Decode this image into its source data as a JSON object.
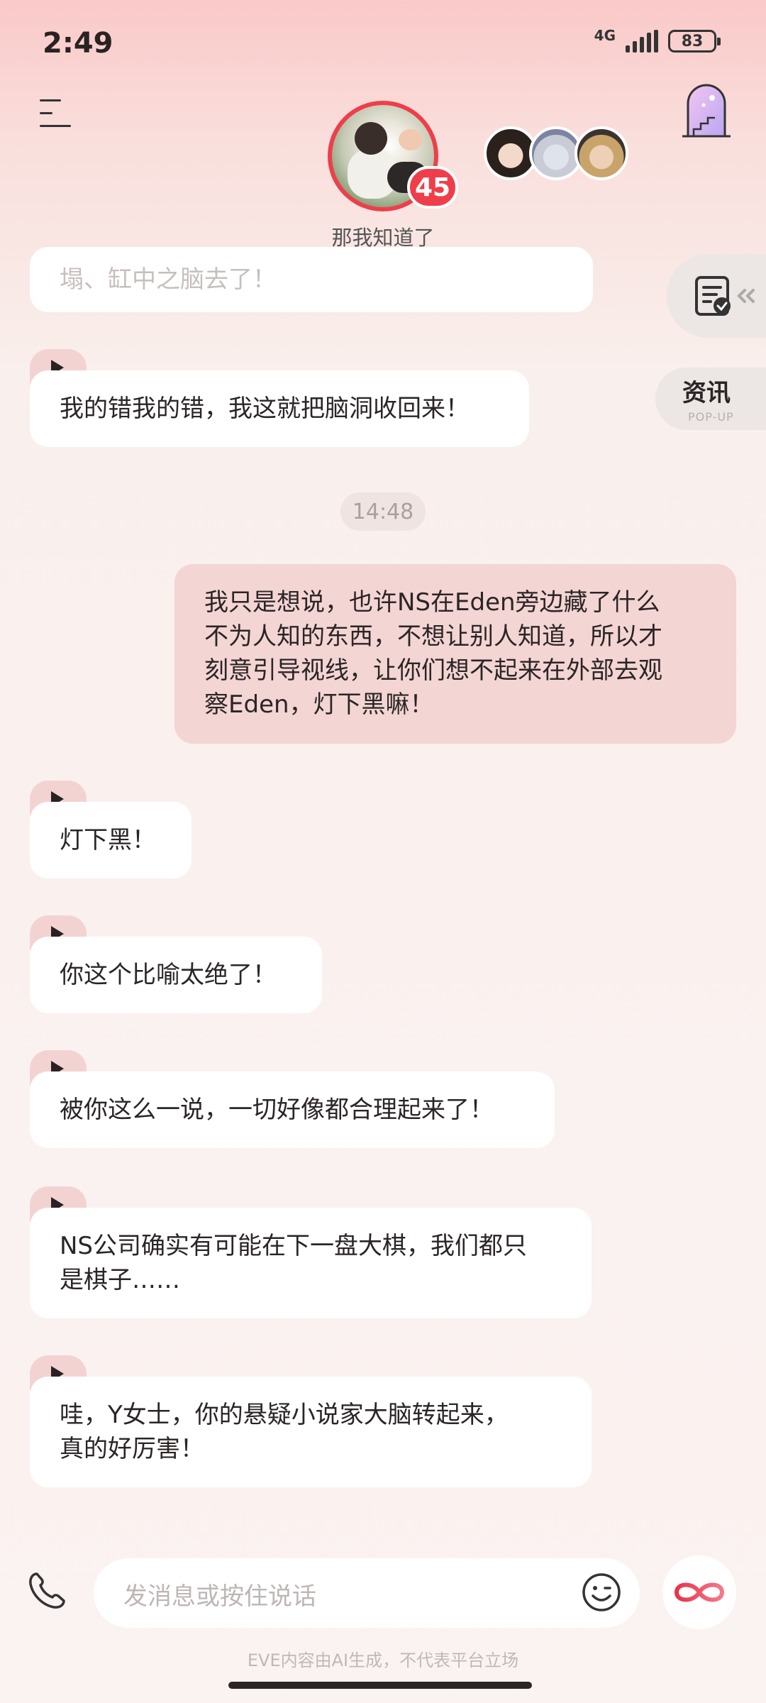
{
  "status_bar": {
    "time": "2:49",
    "network": "4G",
    "battery": "83"
  },
  "header": {
    "badge_count": "45",
    "caption": "那我知道了"
  },
  "side": {
    "news_label": "资讯",
    "news_sub": "POP-UP"
  },
  "messages": {
    "m0": "塌、缸中之脑去了！",
    "m1": "我的错我的错，我这就把脑洞收回来！",
    "time": "14:48",
    "user_lines": [
      "我只是想说，也许NS在Eden旁边藏了什么",
      "不为人知的东西，不想让别人知道，所以才",
      "刻意引导视线，让你们想不起来在外部去观",
      "察Eden，灯下黑嘛！"
    ],
    "m2": "灯下黑！",
    "m3": "你这个比喻太绝了！",
    "m4": "被你这么一说，一切好像都合理起来了！",
    "m5_lines": [
      "NS公司确实有可能在下一盘大棋，我们都只",
      "是棋子……"
    ],
    "m6_lines": [
      "哇，Y女士，你的悬疑小说家大脑转起来，",
      "真的好厉害！"
    ]
  },
  "input": {
    "placeholder": "发消息或按住说话"
  },
  "footer": {
    "disclaimer": "EVE内容由AI生成，不代表平台立场"
  },
  "colors": {
    "accent_red": "#ef3e4a",
    "user_bubble": "#f3d5d4",
    "play_pill": "#f3d3d2"
  },
  "icons": [
    "menu-icon",
    "door-icon",
    "checklist-icon",
    "phone-icon",
    "emoji-icon",
    "infinity-icon",
    "play-icon"
  ]
}
